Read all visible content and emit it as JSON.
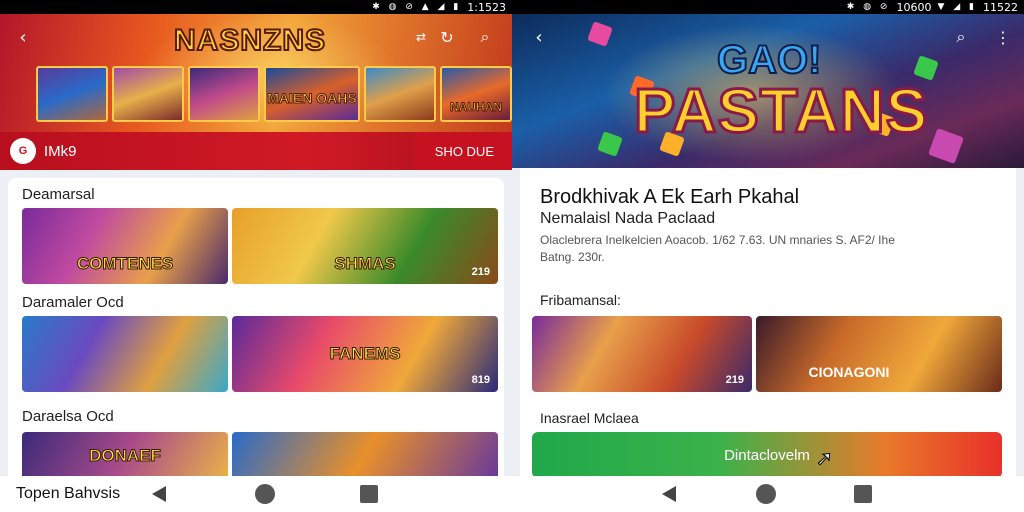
{
  "left": {
    "status": {
      "time": "1:1523"
    },
    "header": {
      "logo": "NASNZNS",
      "cards": [
        "",
        "",
        "",
        "MAIEN OAHS",
        "",
        "NAUHAN"
      ]
    },
    "bar": {
      "app_icon_text": "G",
      "app_name": "IMk9",
      "right_label": "SHO DUE"
    },
    "sections": [
      {
        "title": "Deamarsal",
        "thumbs": [
          {
            "text": "COMTENES",
            "num": ""
          },
          {
            "text": "SHMAS",
            "num": "219"
          }
        ]
      },
      {
        "title": "Daramaler Ocd",
        "thumbs": [
          {
            "text": "",
            "num": ""
          },
          {
            "text": "FANEMS",
            "num": "819"
          }
        ]
      },
      {
        "title": "Daraelsa Ocd",
        "thumbs": [
          {
            "text": "DONAEF",
            "num": ""
          },
          {
            "text": "",
            "num": ""
          }
        ]
      }
    ],
    "nav_label": "Topen Bahvsis"
  },
  "right": {
    "status": {
      "time": "11522",
      "center": "10600"
    },
    "header": {
      "logo_top": "GAO!",
      "logo_main": "PASTANS"
    },
    "title": "Brodkhivak A Ek Earh Pkahal",
    "subtitle": "Nemalaisl Nada Paclaad",
    "meta": "Olaclebrera Inelkelcien Aoacob. 1/62 7.63. UN mnaries S. AF2/ Ihe Batng. 230r.",
    "section1": "Fribamansal:",
    "thumbs": [
      {
        "text": "",
        "num": "219"
      },
      {
        "text": "CIONAGONI",
        "num": ""
      }
    ],
    "section2": "Inasrael Mclaea",
    "download_label": "Dintaclovelm"
  },
  "colors": {
    "brand_red": "#c8141e",
    "download_green": "#1fa84a",
    "download_red": "#e8302a"
  }
}
